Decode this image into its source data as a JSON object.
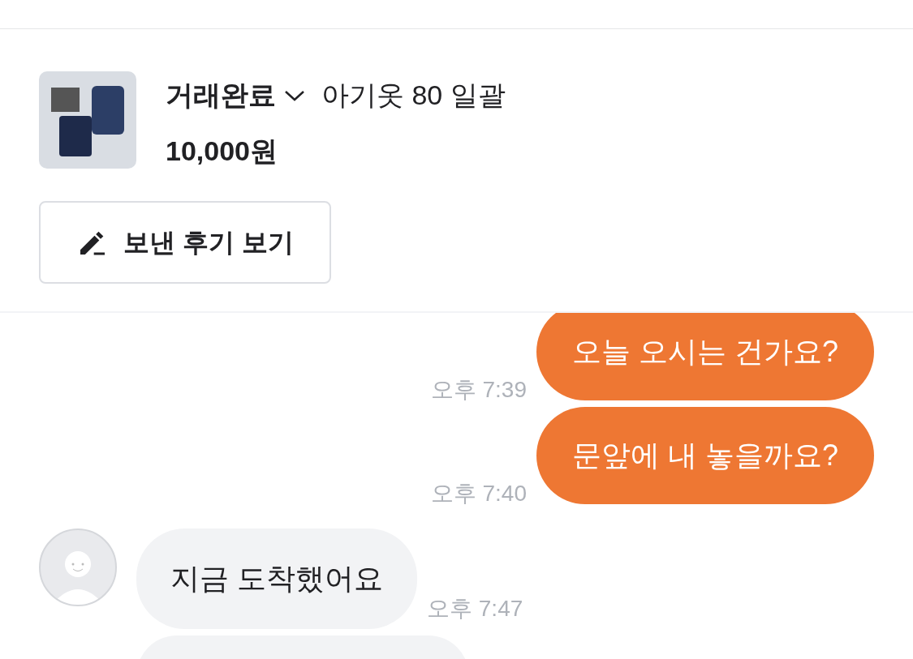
{
  "product": {
    "status": "거래완료",
    "title": "아기옷 80 일괄",
    "price": "10,000원"
  },
  "review_button": {
    "label": "보낸 후기 보기"
  },
  "messages": [
    {
      "kind": "sent",
      "text": "오늘 오시는 건가요?",
      "time": "오후 7:39"
    },
    {
      "kind": "sent",
      "text": "문앞에 내 놓을까요?",
      "time": "오후 7:40"
    },
    {
      "kind": "received",
      "text": "지금 도착했어요",
      "time": "오후 7:47"
    }
  ]
}
